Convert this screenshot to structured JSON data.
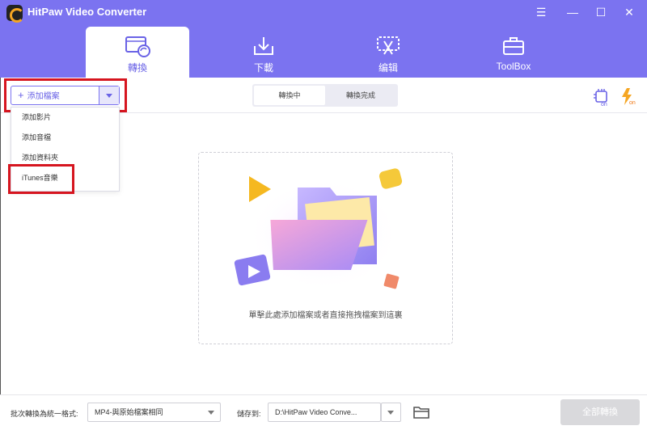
{
  "app": {
    "title": "HitPaw Video Converter"
  },
  "window_controls": {
    "menu": "☰",
    "minimize": "—",
    "maximize": "☐",
    "close": "✕"
  },
  "nav": {
    "tabs": [
      {
        "label": "轉換",
        "icon": "convert-film-icon",
        "active": true
      },
      {
        "label": "下載",
        "icon": "download-icon",
        "active": false
      },
      {
        "label": "编辑",
        "icon": "edit-scissors-icon",
        "active": false
      },
      {
        "label": "ToolBox",
        "icon": "toolbox-icon",
        "active": false
      }
    ]
  },
  "toolbar": {
    "add_file_label": "添加檔案",
    "add_file_plus": "+",
    "segments": [
      "轉換中",
      "轉換完成"
    ],
    "hardware_accel_icon": "cpu-on-icon",
    "speed_icon": "lightning-on-icon"
  },
  "add_menu": {
    "items": [
      "添加影片",
      "添加音檔",
      "添加資料夾",
      "iTunes音樂"
    ]
  },
  "drop_zone": {
    "text": "單擊此處添加檔案或者直接拖拽檔案到這裏"
  },
  "footer": {
    "format_label": "批次轉換為統一格式:",
    "format_value": "MP4-與原始檔案相同",
    "save_label": "儲存到:",
    "save_path": "D:\\HitPaw Video Conve...",
    "convert_all_label": "全部轉換"
  },
  "colors": {
    "accent": "#7b73f0",
    "highlight": "#d6151f",
    "disabled": "#d9d9dc"
  }
}
